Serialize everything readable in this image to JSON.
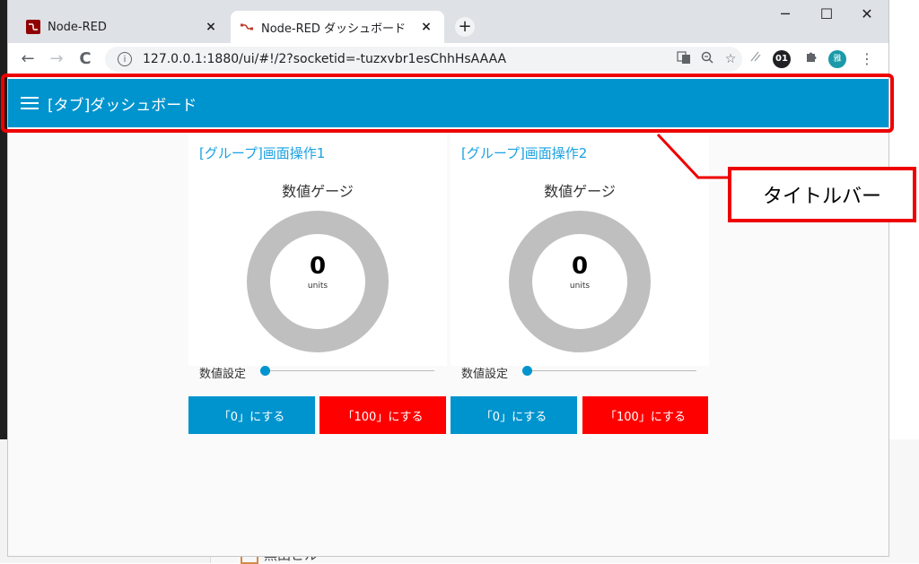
{
  "browser": {
    "tabs": [
      {
        "title": "Node-RED",
        "close": "×"
      },
      {
        "title": "Node-RED ダッシュボード",
        "close": "×"
      }
    ],
    "new_tab": "+",
    "window_controls": {
      "minimize": "─",
      "maximize": "☐",
      "close": "✕"
    },
    "nav": {
      "back": "←",
      "forward": "→",
      "reload": "C"
    },
    "url": "127.0.0.1:1880/ui/#!/2?socketid=-tuzxvbr1esChhHsAAAA",
    "extension_01": "01",
    "profile_initial": "雅",
    "icons": [
      "translate-icon",
      "zoom-icon",
      "star-icon",
      "reader-icon",
      "extension-01-icon",
      "puzzle-icon",
      "profile-avatar",
      "menu-icon"
    ]
  },
  "dashboard": {
    "title": "[タブ]ダッシュボード",
    "groups": [
      {
        "name": "[グループ]画面操作1",
        "gauge": {
          "title": "数値ゲージ",
          "value": "0",
          "units": "units",
          "level": 0
        },
        "slider": {
          "label": "数値設定",
          "value": 0
        },
        "buttons": [
          {
            "label": "「0」にする",
            "color": "#0094ce"
          },
          {
            "label": "「100」にする",
            "color": "#ff0000"
          }
        ]
      },
      {
        "name": "[グループ]画面操作2",
        "gauge": {
          "title": "数値ゲージ",
          "value": "0",
          "units": "units",
          "level": 0
        },
        "slider": {
          "label": "数値設定",
          "value": 0
        },
        "buttons": [
          {
            "label": "「0」にする",
            "color": "#0094ce"
          },
          {
            "label": "「100」にする",
            "color": "#ff0000"
          }
        ]
      }
    ]
  },
  "annotation": {
    "label": "タイトルバー",
    "color": "#ee0000"
  },
  "background": {
    "item_label": "黒田ビル"
  },
  "colors": {
    "accent": "#0094ce",
    "red": "#ff0000",
    "group_title": "#1aa1e1",
    "gauge_ring": "#bfbfbf"
  }
}
